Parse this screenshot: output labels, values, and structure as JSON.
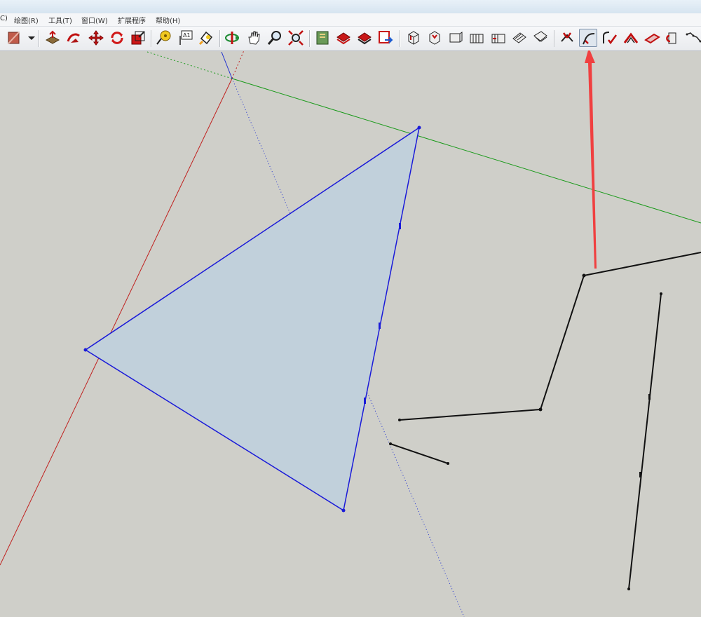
{
  "menu": {
    "items": [
      {
        "label": "C)"
      },
      {
        "label": "绘图(R)"
      },
      {
        "label": "工具(T)"
      },
      {
        "label": "窗口(W)"
      },
      {
        "label": "扩展程序"
      },
      {
        "label": "帮助(H)"
      }
    ]
  },
  "toolbar": {
    "tools": [
      {
        "icon": "materials-icon"
      },
      {
        "icon": "dropdown-arrow-icon"
      },
      {
        "icon": "push-pull-icon"
      },
      {
        "icon": "follow-me-icon"
      },
      {
        "icon": "move-icon"
      },
      {
        "icon": "rotate-icon"
      },
      {
        "icon": "scale-icon"
      },
      {
        "icon": "tape-measure-icon"
      },
      {
        "icon": "text-icon"
      },
      {
        "icon": "paint-bucket-icon"
      },
      {
        "icon": "orbit-icon"
      },
      {
        "icon": "pan-icon"
      },
      {
        "icon": "zoom-icon"
      },
      {
        "icon": "zoom-extents-icon"
      },
      {
        "icon": "warehouse-icon"
      },
      {
        "icon": "share-model-icon"
      },
      {
        "icon": "extension-warehouse-icon"
      },
      {
        "icon": "send-to-layout-icon"
      },
      {
        "icon": "iso-view-icon"
      },
      {
        "icon": "top-view-icon"
      },
      {
        "icon": "front-view-icon"
      },
      {
        "icon": "right-view-icon"
      },
      {
        "icon": "back-view-icon"
      },
      {
        "icon": "left-view-icon"
      },
      {
        "icon": "bottom-view-icon"
      },
      {
        "icon": "make-face-icon"
      },
      {
        "icon": "weld-edges-icon"
      },
      {
        "icon": "fillet-icon"
      },
      {
        "icon": "chamfer-icon"
      },
      {
        "icon": "extrude-icon"
      },
      {
        "icon": "rotate-face-icon"
      },
      {
        "icon": "curve-icon"
      }
    ],
    "active_tool": "weld-edges-icon"
  },
  "canvas": {
    "axis_colors": {
      "red": "#c0201e",
      "green": "#1a9a1a",
      "blue": "#1e2fd0"
    },
    "face_fill": "#c1d0db",
    "face_edge_color": "#1a1ad8",
    "edge_color": "#111111",
    "annotation_arrow_color": "#f04040"
  },
  "a11y": {
    "viewport": "model viewport"
  }
}
